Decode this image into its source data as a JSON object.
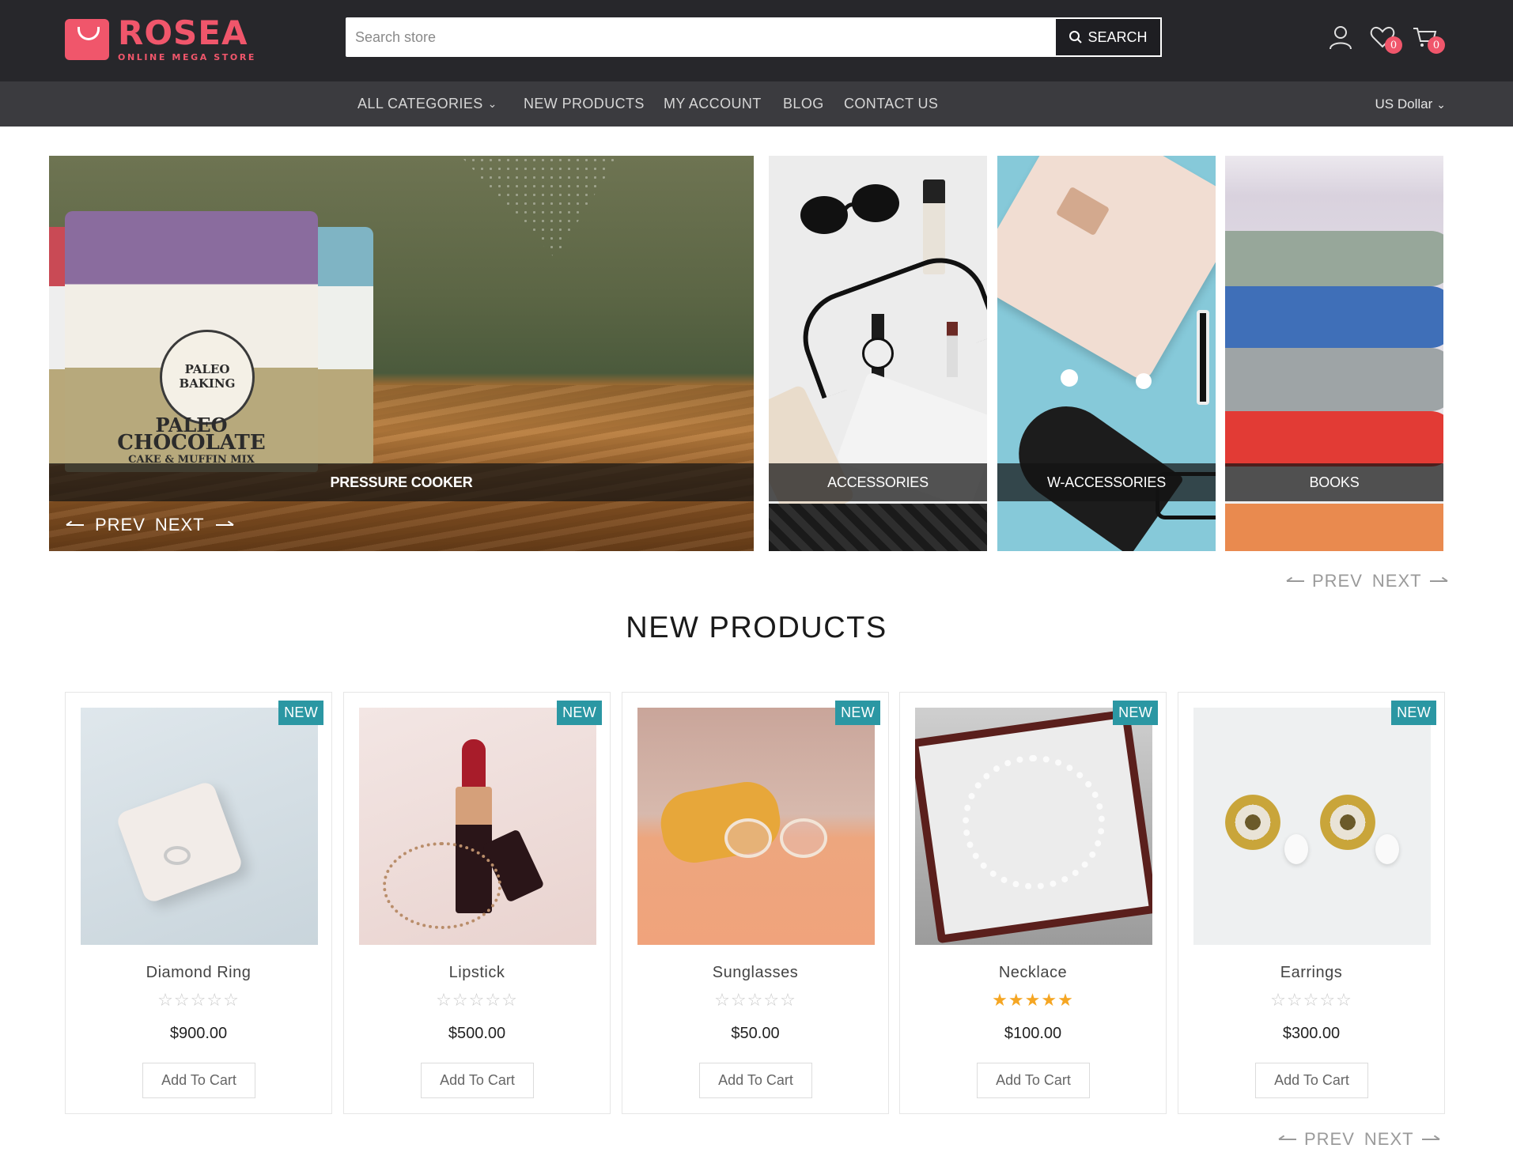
{
  "brand": {
    "name": "ROSEA",
    "tagline": "ONLINE MEGA STORE",
    "accent": "#f0566b"
  },
  "search": {
    "placeholder": "Search store",
    "button_label": "SEARCH"
  },
  "header_icons": {
    "account": "user-icon",
    "wishlist": "heart-icon",
    "wishlist_count": "0",
    "cart": "cart-icon",
    "cart_count": "0"
  },
  "nav": {
    "items": [
      "ALL CATEGORIES",
      "NEW PRODUCTS",
      "MY ACCOUNT",
      "BLOG",
      "CONTACT US"
    ],
    "currency": "US Dollar"
  },
  "hero": {
    "main_caption": "PRESSURE COOKER",
    "prev_label": "PREV",
    "next_label": "NEXT",
    "package_lines": [
      "PALEO",
      "CHOCOLATE",
      "CAKE & MUFFIN MIX"
    ],
    "package_brand": "PALEO BAKING"
  },
  "categories": [
    {
      "label": "ACCESSORIES"
    },
    {
      "label": "W-ACCESSORIES"
    },
    {
      "label": "BOOKS"
    }
  ],
  "category_nav": {
    "prev_label": "PREV",
    "next_label": "NEXT"
  },
  "new_products": {
    "title": "NEW PRODUCTS",
    "badge": "NEW",
    "add_to_cart": "Add To Cart",
    "items": [
      {
        "name": "Diamond Ring",
        "price": "$900.00",
        "rating": 0
      },
      {
        "name": "Lipstick",
        "price": "$500.00",
        "rating": 0
      },
      {
        "name": "Sunglasses",
        "price": "$50.00",
        "rating": 0
      },
      {
        "name": "Necklace",
        "price": "$100.00",
        "rating": 5
      },
      {
        "name": "Earrings",
        "price": "$300.00",
        "rating": 0
      }
    ],
    "prev_label": "PREV",
    "next_label": "NEXT"
  },
  "colors": {
    "header_bg": "#27272b",
    "nav_bg": "#3b3b3f",
    "badge_teal": "#2b97a3",
    "star_on": "#f5a623"
  }
}
